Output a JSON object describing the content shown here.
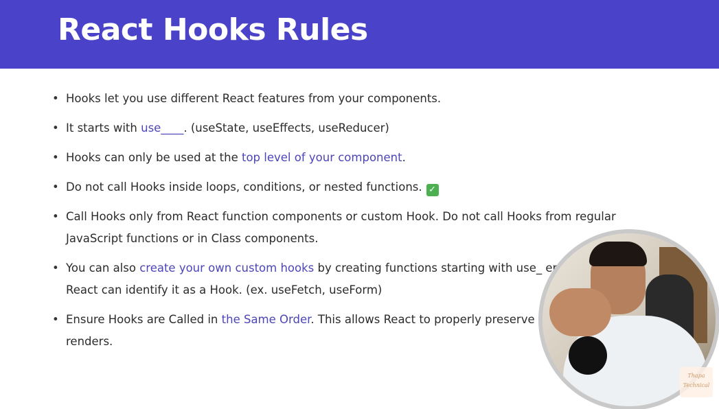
{
  "slide": {
    "title": "React Hooks Rules",
    "rules": [
      {
        "parts": [
          {
            "t": "Hooks let you use different React features from your components."
          }
        ]
      },
      {
        "parts": [
          {
            "t": "It starts with "
          },
          {
            "t": "use____",
            "hl": true
          },
          {
            "t": ". (useState, useEffects, useReducer)"
          }
        ]
      },
      {
        "parts": [
          {
            "t": "Hooks can only be used at the "
          },
          {
            "t": "top level of your component",
            "hl": true
          },
          {
            "t": "."
          }
        ]
      },
      {
        "parts": [
          {
            "t": "Do not call Hooks inside loops, conditions, or nested functions."
          },
          {
            "t": "✓",
            "icon": "checkmark-icon"
          }
        ]
      },
      {
        "parts": [
          {
            "t": "Call Hooks only from React function components or custom Hook. Do not call Hooks from regular JavaScript functions or in Class components."
          }
        ]
      },
      {
        "parts": [
          {
            "t": "You can also "
          },
          {
            "t": "create your own custom hooks",
            "hl": true
          },
          {
            "t": " by creating functions starting with use_ "
          },
          {
            "t": "ensures that React can identify it as a Hook. (ex. useFetch, useForm)"
          }
        ]
      },
      {
        "parts": [
          {
            "t": "Ensure Hooks are Called in "
          },
          {
            "t": "the Same Order",
            "hl": true
          },
          {
            "t": ". This allows React to properly preserve t "
          },
          {
            "t": "between re-renders."
          }
        ]
      }
    ]
  },
  "watermark": {
    "line1": "Thapa",
    "line2": "Technical"
  }
}
